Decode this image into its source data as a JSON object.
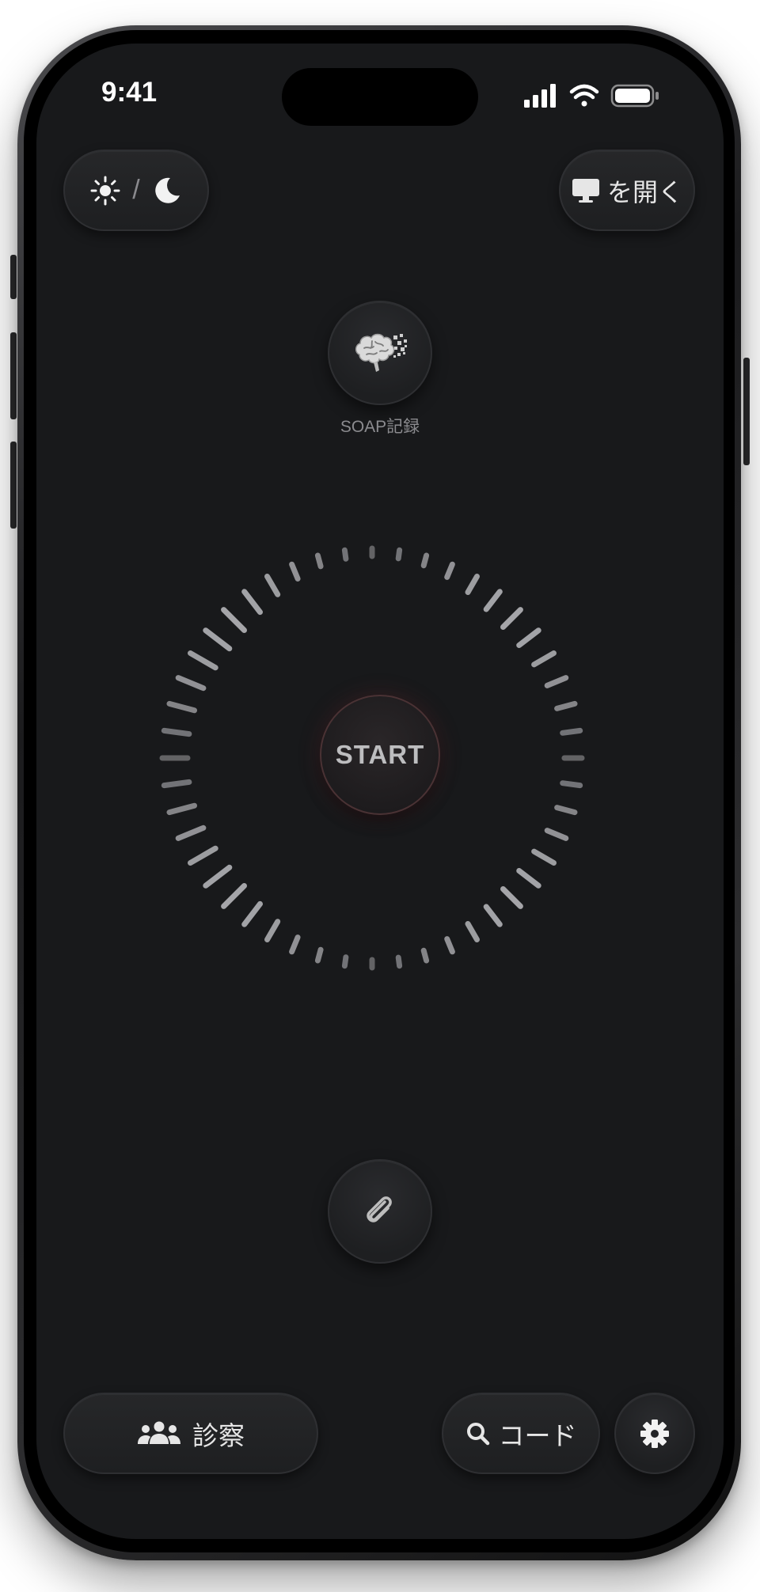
{
  "status_bar": {
    "time": "9:41",
    "icons": [
      "cellular-signal-icon",
      "wifi-icon",
      "battery-icon"
    ]
  },
  "header": {
    "theme_toggle": {
      "light_icon": "sun-icon",
      "separator": "/",
      "dark_icon": "moon-icon"
    },
    "open_button": {
      "icon": "desktop-monitor-icon",
      "label": "を開く"
    }
  },
  "soap": {
    "icon": "brain-icon",
    "label": "SOAP記録"
  },
  "recorder": {
    "start_label": "START",
    "ring": "level-tick-ring"
  },
  "attachment": {
    "icon": "paperclip-icon"
  },
  "bottom_bar": {
    "consultation_button": {
      "icon": "users-group-icon",
      "label": "診察"
    },
    "code_button": {
      "icon": "search-icon",
      "label": "コード"
    },
    "settings_button": {
      "icon": "gear-icon"
    }
  },
  "colors": {
    "screen_background": "#18191b",
    "button_surface": "#232426",
    "start_glow": "#a03c46",
    "text_primary": "#e6e6e6",
    "text_muted": "#8b8b8f"
  }
}
